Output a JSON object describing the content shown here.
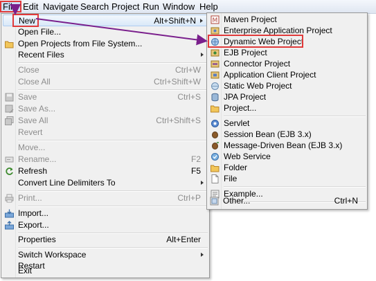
{
  "menubar": {
    "items": [
      "File",
      "Edit",
      "Navigate",
      "Search",
      "Project",
      "Run",
      "Window",
      "Help"
    ]
  },
  "file_menu": {
    "new": {
      "label": "New",
      "accel": "Alt+Shift+N"
    },
    "open_file": {
      "label": "Open File..."
    },
    "open_projects": {
      "label": "Open Projects from File System..."
    },
    "recent_files": {
      "label": "Recent Files"
    },
    "close": {
      "label": "Close",
      "accel": "Ctrl+W"
    },
    "close_all": {
      "label": "Close All",
      "accel": "Ctrl+Shift+W"
    },
    "save": {
      "label": "Save",
      "accel": "Ctrl+S"
    },
    "save_as": {
      "label": "Save As..."
    },
    "save_all": {
      "label": "Save All",
      "accel": "Ctrl+Shift+S"
    },
    "revert": {
      "label": "Revert"
    },
    "move": {
      "label": "Move..."
    },
    "rename": {
      "label": "Rename...",
      "accel": "F2"
    },
    "refresh": {
      "label": "Refresh",
      "accel": "F5"
    },
    "convert": {
      "label": "Convert Line Delimiters To"
    },
    "print": {
      "label": "Print...",
      "accel": "Ctrl+P"
    },
    "import": {
      "label": "Import..."
    },
    "export": {
      "label": "Export..."
    },
    "properties": {
      "label": "Properties",
      "accel": "Alt+Enter"
    },
    "switch_workspace": {
      "label": "Switch Workspace"
    },
    "restart": {
      "label": "Restart"
    },
    "exit": {
      "label": "Exit"
    }
  },
  "new_submenu": {
    "maven": {
      "label": "Maven Project"
    },
    "enterprise": {
      "label": "Enterprise Application Project"
    },
    "dynamic_web": {
      "label": "Dynamic Web Project"
    },
    "ejb": {
      "label": "EJB Project"
    },
    "connector": {
      "label": "Connector Project"
    },
    "app_client": {
      "label": "Application Client Project"
    },
    "static_web": {
      "label": "Static Web Project"
    },
    "jpa": {
      "label": "JPA Project"
    },
    "project": {
      "label": "Project..."
    },
    "servlet": {
      "label": "Servlet"
    },
    "session_bean": {
      "label": "Session Bean (EJB 3.x)"
    },
    "mdb": {
      "label": "Message-Driven Bean (EJB 3.x)"
    },
    "web_service": {
      "label": "Web Service"
    },
    "folder": {
      "label": "Folder"
    },
    "file": {
      "label": "File"
    },
    "example": {
      "label": "Example..."
    },
    "other": {
      "label": "Other...",
      "accel": "Ctrl+N"
    }
  },
  "colors": {
    "highlight_box": "#e03a3a",
    "annotation_arrow": "#7a1f8c",
    "selection": "#d9e8f8",
    "menu_bg": "#f0f0f0",
    "disabled_text": "#8d8d8d"
  }
}
